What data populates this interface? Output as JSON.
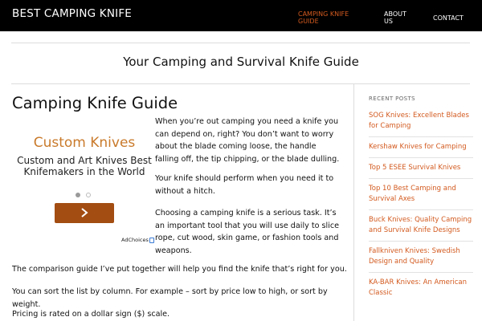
{
  "header": {
    "site_title": "BEST CAMPING KNIFE",
    "nav": [
      {
        "label": "CAMPING KNIFE GUIDE",
        "active": true
      },
      {
        "label": "ABOUT US",
        "active": false
      },
      {
        "label": "CONTACT",
        "active": false
      }
    ]
  },
  "tagline": "Your Camping and Survival Knife Guide",
  "main": {
    "page_title": "Camping Knife Guide",
    "paragraphs": [
      "When you’re out camping you need a knife you can depend on, right? You don’t want to worry about the blade coming loose, the handle falling off, the tip chipping, or the blade dulling.",
      "Your knife should perform when you need it to without a hitch.",
      "Choosing a camping knife is a serious task. It’s an important tool that you will use daily to slice rope, cut wood, skin game, or fashion tools and weapons.",
      "The comparison guide I’ve put together will help you find the knife that’s right for you.",
      "You can sort the list by column. For example – sort by price low to high, or sort by weight.",
      "Pricing is rated on a dollar sign ($) scale."
    ]
  },
  "ad": {
    "title": "Custom Knives",
    "body": "Custom and Art Knives Best Knifemakers in the World",
    "button_icon": "chevron-right-icon",
    "adchoices": "AdChoices",
    "title_color": "#c97a2b",
    "button_color": "#a34d12"
  },
  "sidebar": {
    "widget_title": "RECENT POSTS",
    "posts": [
      "SOG Knives: Excellent Blades for Camping",
      "Kershaw Knives for Camping",
      "Top 5 ESEE Survival Knives",
      "Top 10 Best Camping and Survival Axes",
      "Buck Knives: Quality Camping and Survival Knife Designs",
      "Fallkniven Knives: Swedish Design and Quality",
      "KA-BAR Knives: An American Classic"
    ]
  },
  "colors": {
    "accent": "#d35a1f",
    "topbar": "#000000"
  }
}
